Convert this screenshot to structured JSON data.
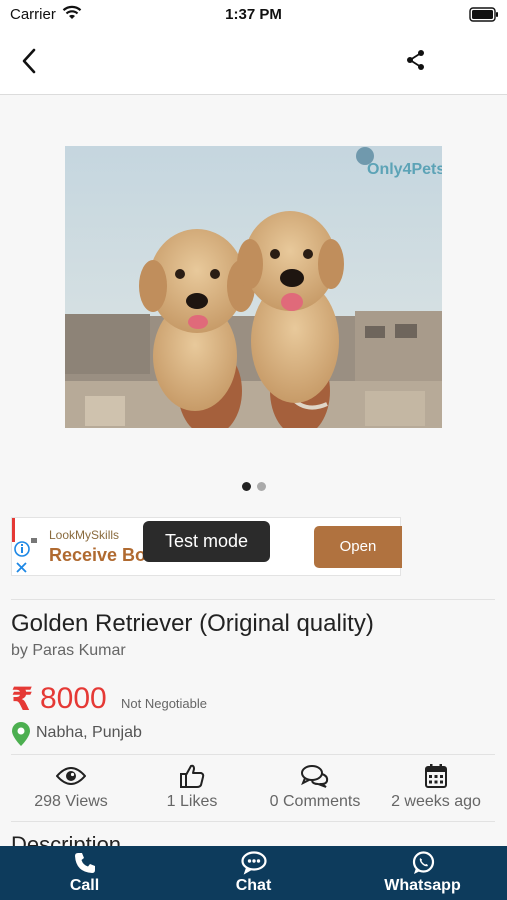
{
  "status_bar": {
    "carrier": "Carrier",
    "time": "1:37 PM"
  },
  "listing": {
    "title": "Golden Retriever (Original quality)",
    "seller": "by Paras Kumar",
    "currency_symbol": "₹",
    "price": "8000",
    "negotiable": "Not Negotiable",
    "location": "Nabha, Punjab",
    "description_heading": "Description"
  },
  "gallery": {
    "watermark": "Only4Pets",
    "active_index": 0,
    "count": 2
  },
  "ad": {
    "brand": "LookMySkills",
    "headline": "Receive Bo                    ers",
    "cta": "Open"
  },
  "toast": "Test mode",
  "stats": [
    {
      "icon": "eye-icon",
      "label": "298 Views"
    },
    {
      "icon": "thumbs-up-icon",
      "label": "1 Likes"
    },
    {
      "icon": "comments-icon",
      "label": "0 Comments"
    },
    {
      "icon": "calendar-icon",
      "label": "2 weeks ago"
    }
  ],
  "bottom_bar": [
    {
      "icon": "phone-icon",
      "label": "Call"
    },
    {
      "icon": "chat-icon",
      "label": "Chat"
    },
    {
      "icon": "whatsapp-icon",
      "label": "Whatsapp"
    }
  ],
  "colors": {
    "price": "#e53935",
    "bottom_bar": "#0d3b5c",
    "ad_button": "#b0723f",
    "location_pin": "#4caf50"
  }
}
